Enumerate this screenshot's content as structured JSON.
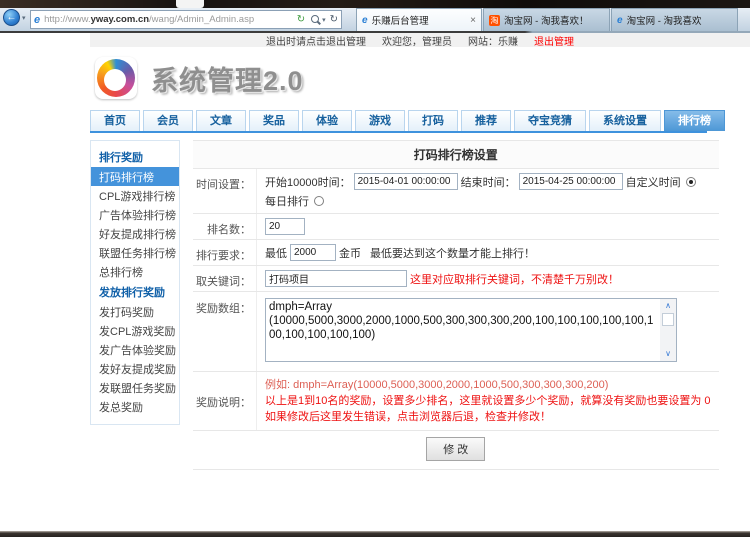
{
  "colors": {
    "accent_blue": "#3e92dd",
    "alert_red": "#ee1111",
    "logout_red": "#ff0000",
    "taobao_orange": "#ff5000"
  },
  "browser": {
    "url_parts": {
      "prefix": "http://www.",
      "domain": "yway.com.cn",
      "path": "/wang/Admin_Admin.asp"
    },
    "icons": {
      "back": "←",
      "dropdown": "▾",
      "page": "e",
      "compat": "↻",
      "refresh": "↻",
      "close": "×",
      "taobao": "淘",
      "scroll_up": "∧",
      "scroll_down": "∨"
    },
    "tabs": [
      {
        "title": "乐赚后台管理",
        "active": true
      },
      {
        "title": "淘宝网 - 淘我喜欢！",
        "active": false
      },
      {
        "title": "淘宝网 - 淘我喜欢",
        "active": false
      }
    ]
  },
  "welcome_bar": {
    "exit_tip": "退出时请点击退出管理",
    "welcome": "欢迎您，管理员",
    "site": "网站：乐赚",
    "logout": "退出管理"
  },
  "site": {
    "logo_title": "系统管理2.0"
  },
  "nav": {
    "items": [
      "首页",
      "会员",
      "文章",
      "奖品",
      "体验",
      "游戏",
      "打码",
      "推荐",
      "夺宝竞猜",
      "系统设置",
      "排行榜"
    ]
  },
  "sidebar": {
    "sections": [
      {
        "header": "排行奖励",
        "items": [
          {
            "label": "打码排行榜",
            "active": true
          },
          {
            "label": "CPL游戏排行榜",
            "active": false
          },
          {
            "label": "广告体验排行榜",
            "active": false
          },
          {
            "label": "好友提成排行榜",
            "active": false
          },
          {
            "label": "联盟任务排行榜",
            "active": false
          },
          {
            "label": "总排行榜",
            "active": false
          }
        ]
      },
      {
        "header": "发放排行奖励",
        "items": [
          {
            "label": "发打码奖励",
            "active": false
          },
          {
            "label": "发CPL游戏奖励",
            "active": false
          },
          {
            "label": "发广告体验奖励",
            "active": false
          },
          {
            "label": "发好友提成奖励",
            "active": false
          },
          {
            "label": "发联盟任务奖励",
            "active": false
          },
          {
            "label": "发总奖励",
            "active": false
          }
        ]
      }
    ]
  },
  "form": {
    "title": "打码排行榜设置",
    "time_row": {
      "label": "时间设置：",
      "start_label": "开始10000时间：",
      "start_value": "2015-04-01 00:00:00",
      "end_label": "结束时间：",
      "end_value": "2015-04-25 00:00:00",
      "custom_radio_label": "自定义时间",
      "daily_radio_label": "每日排行"
    },
    "rank_row": {
      "label": "排名数：",
      "value": "20"
    },
    "require_row": {
      "label": "排行要求：",
      "min_label": "最低",
      "value": "2000",
      "unit": "金币",
      "note": "最低要达到这个数量才能上排行！"
    },
    "keyword_row": {
      "label": "取关键词：",
      "value": "打码项目",
      "note": "这里对应取排行关键词，不清楚千万别改！"
    },
    "array_row": {
      "label": "奖励数组：",
      "value": "dmph=Array\n(10000,5000,3000,2000,1000,500,300,300,300,200,100,100,100,100,100,100,100,100,100,100)"
    },
    "desc_row": {
      "label": "奖励说明：",
      "example": "例如: dmph=Array(10000,5000,3000,2000,1000,500,300,300,300,200)",
      "line2": "以上是1到10名的奖励，设置多少排名，这里就设置多少个奖励，就算没有奖励也要设置为 0",
      "line3": "如果修改后这里发生错误，点击浏览器后退，检查并修改！"
    },
    "submit_label": "修 改"
  }
}
